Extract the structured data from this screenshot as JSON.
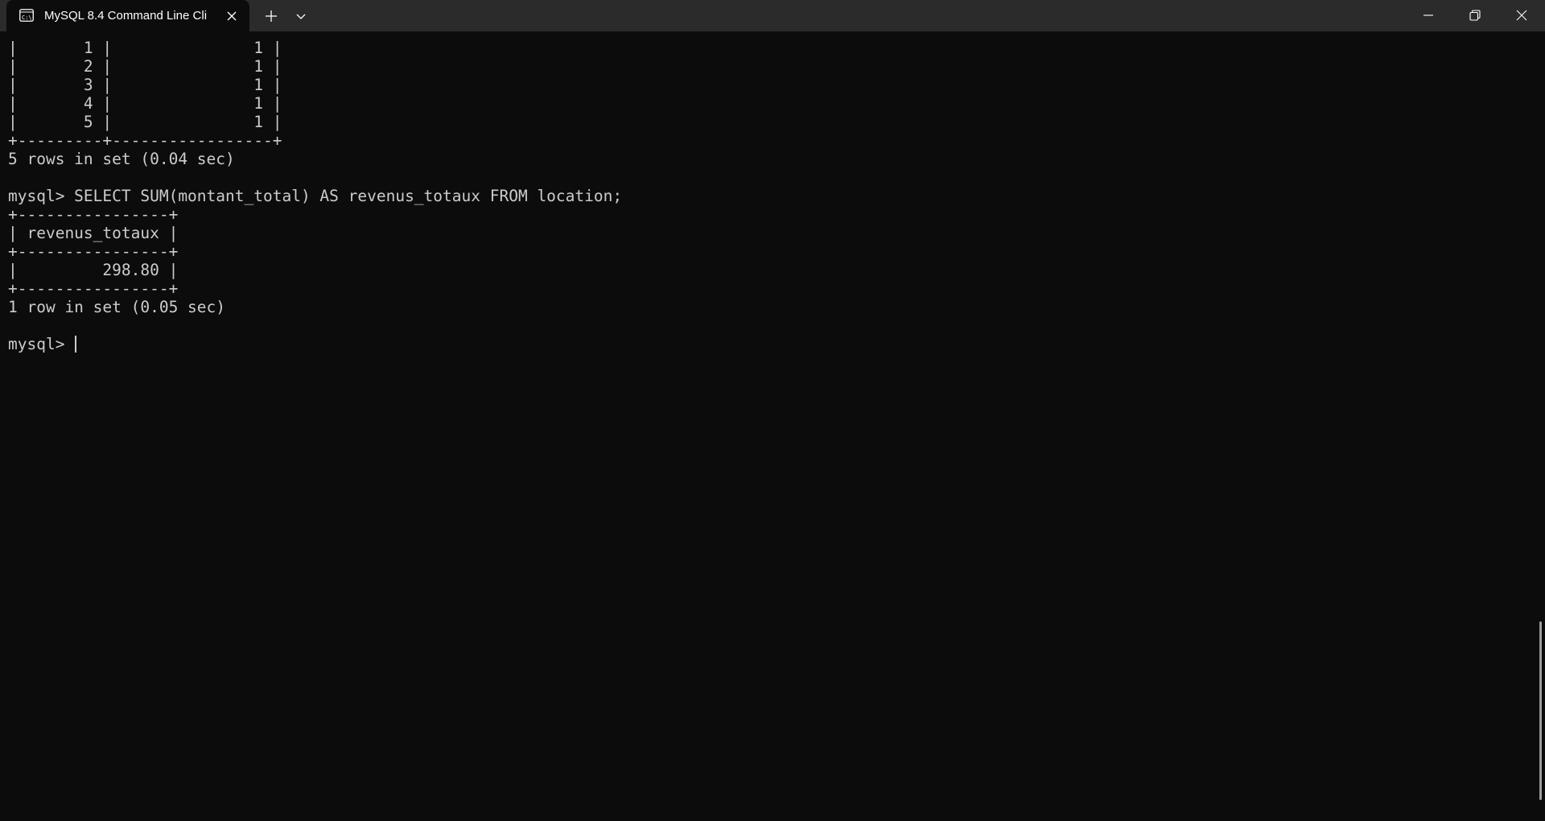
{
  "window": {
    "tab_title": "MySQL 8.4 Command Line Cli",
    "tab_icon": "terminal-icon",
    "new_tab_icon": "plus-icon",
    "dropdown_icon": "chevron-down-icon"
  },
  "terminal": {
    "lines": [
      "|       1 |               1 |",
      "|       2 |               1 |",
      "|       3 |               1 |",
      "|       4 |               1 |",
      "|       5 |               1 |",
      "+---------+-----------------+",
      "5 rows in set (0.04 sec)",
      "",
      "mysql> SELECT SUM(montant_total) AS revenus_totaux FROM location;",
      "+----------------+",
      "| revenus_totaux |",
      "+----------------+",
      "|         298.80 |",
      "+----------------+",
      "1 row in set (0.05 sec)",
      ""
    ],
    "prompt": "mysql> "
  },
  "colors": {
    "background": "#0c0c0c",
    "titlebar": "#2b2b2b",
    "text": "#cccccc"
  }
}
